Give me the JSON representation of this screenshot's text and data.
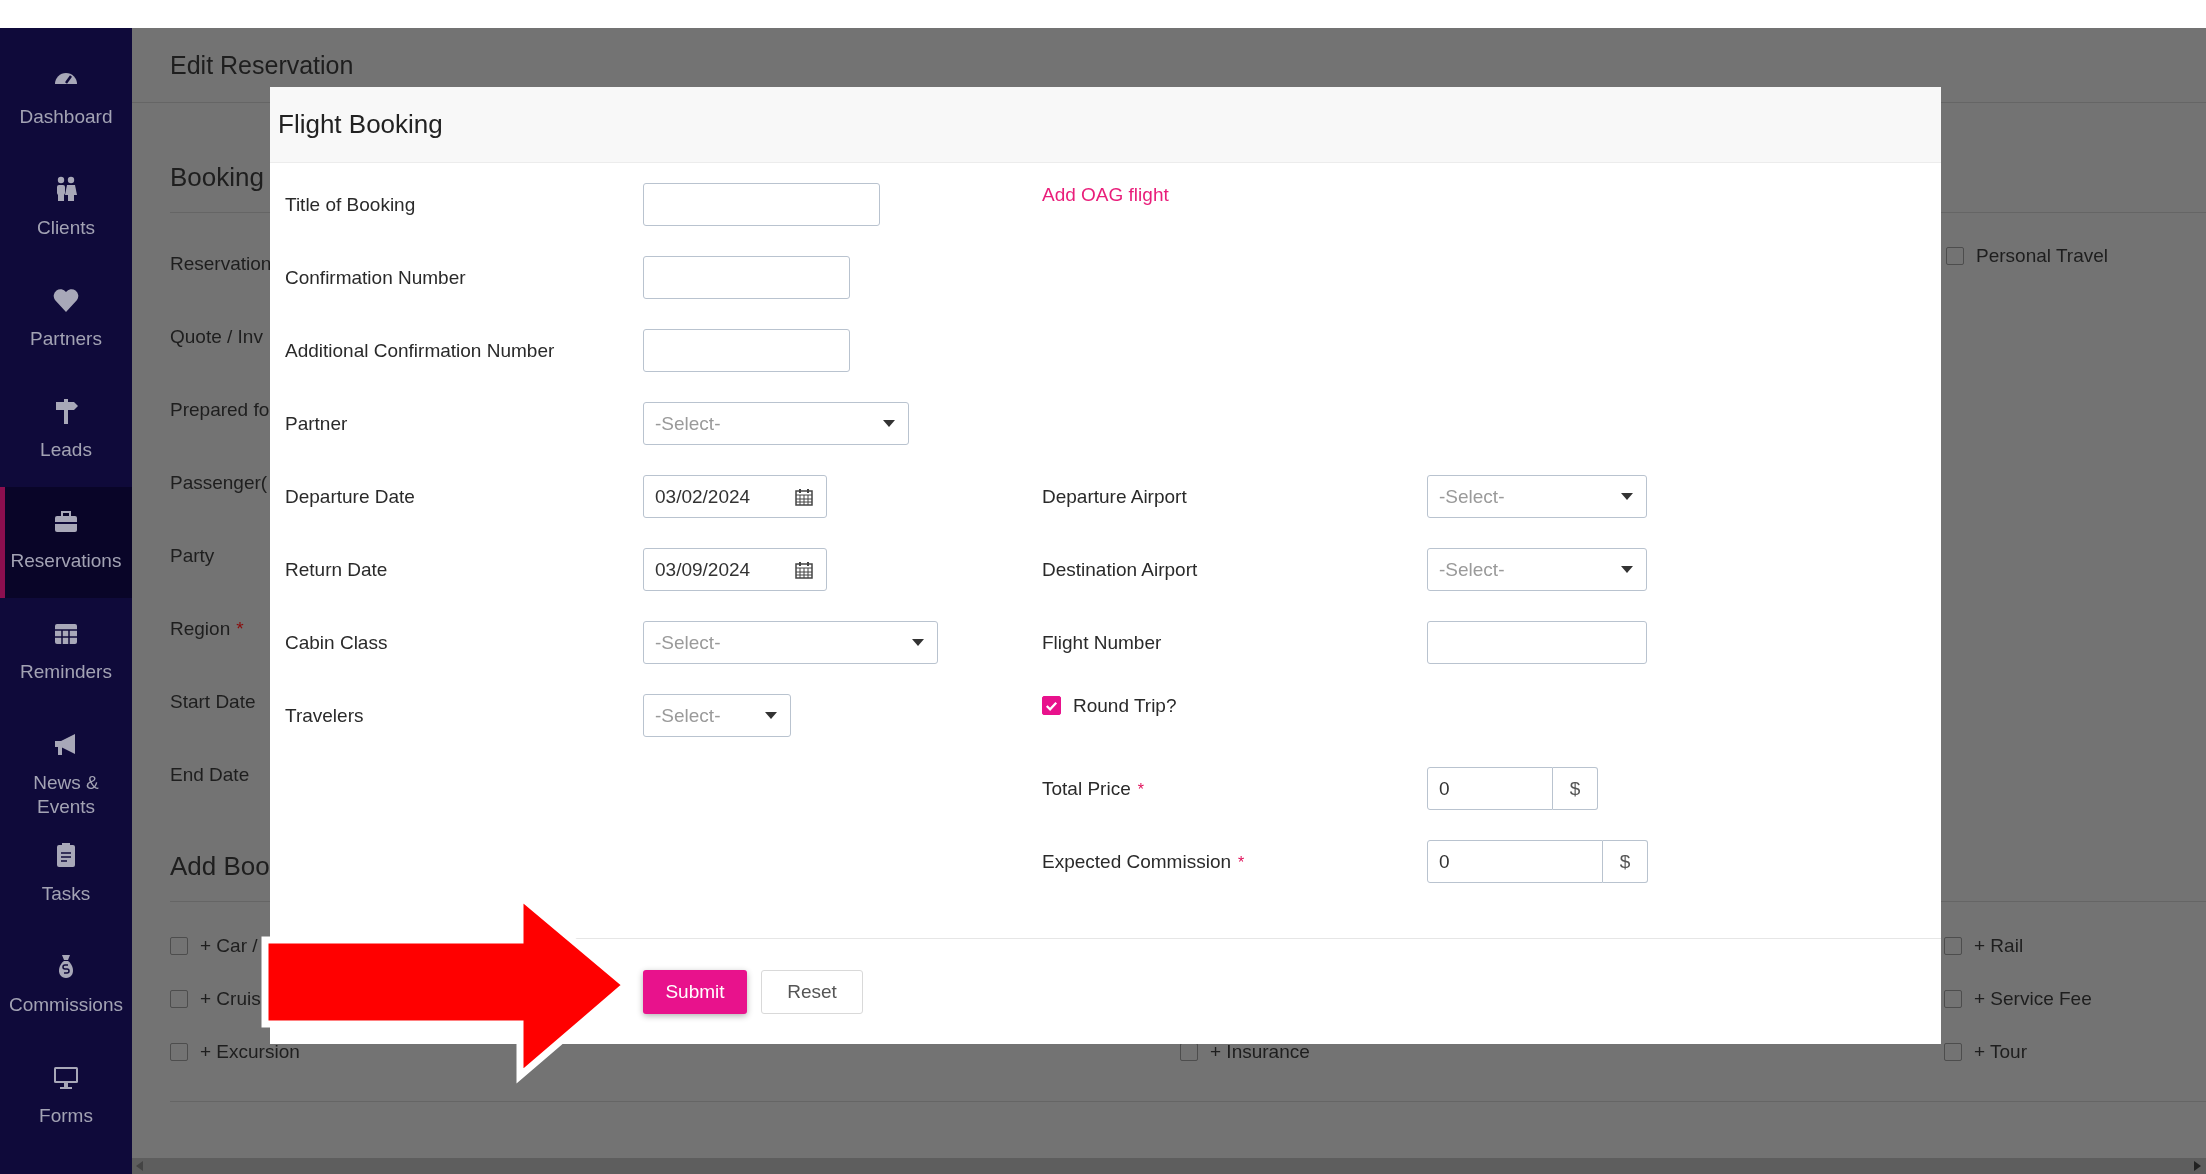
{
  "sidebar": {
    "items": [
      {
        "label": "Dashboard",
        "selected": false
      },
      {
        "label": "Clients",
        "selected": false
      },
      {
        "label": "Partners",
        "selected": false
      },
      {
        "label": "Leads",
        "selected": false
      },
      {
        "label": "Reservations",
        "selected": true
      },
      {
        "label": "Reminders",
        "selected": false
      },
      {
        "label": "News & Events",
        "selected": false
      },
      {
        "label": "Tasks",
        "selected": false
      },
      {
        "label": "Commissions",
        "selected": false
      },
      {
        "label": "Forms",
        "selected": false
      }
    ]
  },
  "page": {
    "title": "Edit Reservation",
    "booking_heading": "Booking",
    "fields": [
      {
        "label": "Reservation"
      },
      {
        "label": "Quote / Inv"
      },
      {
        "label": "Prepared fo"
      },
      {
        "label": "Passenger("
      },
      {
        "label": "Party"
      },
      {
        "label": "Region",
        "required_mark": "*"
      },
      {
        "label": "Start Date"
      },
      {
        "label": "End Date"
      }
    ],
    "personal_travel": {
      "label": "Personal Travel",
      "checked": false
    },
    "add_heading": "Add Boo",
    "add_option_columns": [
      {
        "items": [
          {
            "label": "+ Car /",
            "checked": false
          },
          {
            "label": "+ Cruis",
            "checked": false
          },
          {
            "label": "+ Excursion",
            "checked": false
          }
        ]
      },
      {
        "items": [
          {
            "label": "+ Insurance",
            "checked": false
          }
        ]
      },
      {
        "items": [
          {
            "label": "+ Rail",
            "checked": false
          },
          {
            "label": "+ Service Fee",
            "checked": false
          },
          {
            "label": "+ Tour",
            "checked": false
          }
        ]
      }
    ]
  },
  "modal": {
    "title": "Flight Booking",
    "left_fields": [
      {
        "kind": "text",
        "label": "Title of Booking"
      },
      {
        "kind": "text",
        "label": "Confirmation Number"
      },
      {
        "kind": "text",
        "label": "Additional Confirmation Number"
      },
      {
        "kind": "select",
        "label": "Partner",
        "placeholder": "-Select-"
      },
      {
        "kind": "date",
        "label": "Departure Date",
        "value": "03/02/2024"
      },
      {
        "kind": "date",
        "label": "Return Date",
        "value": "03/09/2024"
      },
      {
        "kind": "select",
        "label": "Cabin Class",
        "placeholder": "-Select-"
      },
      {
        "kind": "select",
        "label": "Travelers",
        "placeholder": "-Select-"
      }
    ],
    "link": "Add OAG flight",
    "right_fields": [
      {
        "kind": "select",
        "label": "Departure Airport",
        "placeholder": "-Select-"
      },
      {
        "kind": "select",
        "label": "Destination Airport",
        "placeholder": "-Select-"
      },
      {
        "kind": "text",
        "label": "Flight Number"
      },
      {
        "kind": "checkbox",
        "label": "Round Trip?",
        "checked": true
      },
      {
        "kind": "money",
        "label": "Total Price",
        "required_mark": "*",
        "value": "0",
        "addon": "$"
      },
      {
        "kind": "money",
        "label": "Expected Commission",
        "required_mark": "*",
        "value": "0",
        "addon": "$"
      }
    ],
    "buttons": [
      {
        "kind": "primary",
        "label": "Submit"
      },
      {
        "kind": "secondary",
        "label": "Reset"
      }
    ]
  }
}
